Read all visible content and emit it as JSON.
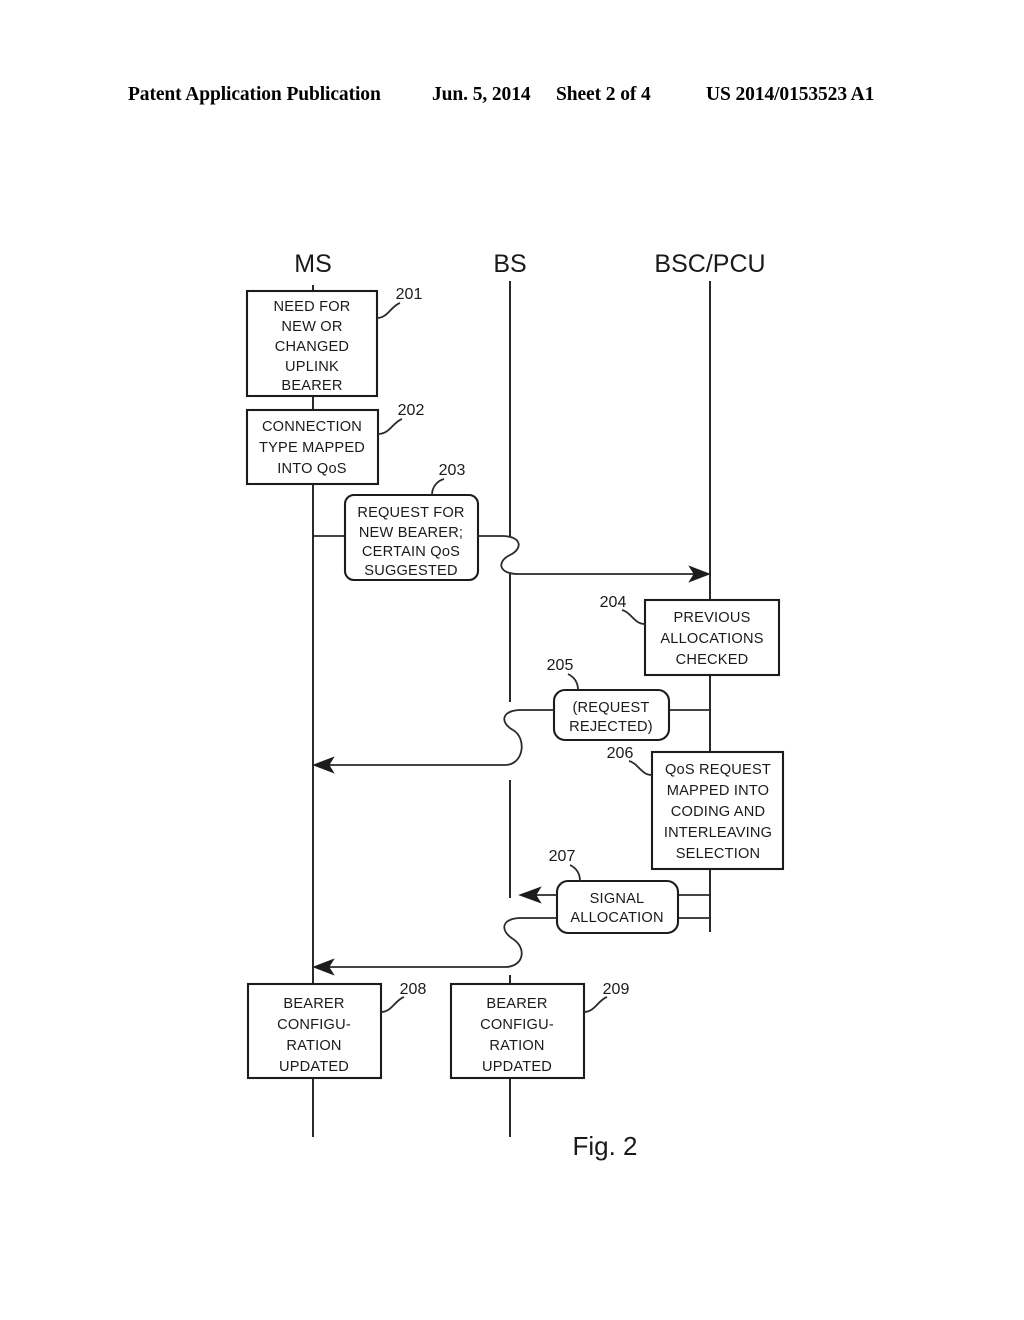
{
  "header": {
    "publication": "Patent Application Publication",
    "date": "Jun. 5, 2014",
    "sheet": "Sheet 2 of 4",
    "patent_number": "US 2014/0153523 A1"
  },
  "figure": {
    "caption": "Fig. 2",
    "lifelines": [
      {
        "id": "ms",
        "label": "MS"
      },
      {
        "id": "bs",
        "label": "BS"
      },
      {
        "id": "bscpcu",
        "label": "BSC/PCU"
      }
    ],
    "boxes": [
      {
        "ref": "201",
        "lines": [
          "NEED FOR",
          "NEW OR",
          "CHANGED",
          "UPLINK",
          "BEARER"
        ],
        "shape": "rect",
        "lane": "ms"
      },
      {
        "ref": "202",
        "lines": [
          "CONNECTION",
          "TYPE MAPPED",
          "INTO QoS"
        ],
        "shape": "rect",
        "lane": "ms"
      },
      {
        "ref": "203",
        "lines": [
          "REQUEST FOR",
          "NEW BEARER;",
          "CERTAIN QoS",
          "SUGGESTED"
        ],
        "shape": "rounded",
        "lane": "ms-bs"
      },
      {
        "ref": "204",
        "lines": [
          "PREVIOUS",
          "ALLOCATIONS",
          "CHECKED"
        ],
        "shape": "rect",
        "lane": "bscpcu"
      },
      {
        "ref": "205",
        "lines": [
          "(REQUEST",
          "REJECTED)"
        ],
        "shape": "rounded",
        "lane": "bs-bscpcu"
      },
      {
        "ref": "206",
        "lines": [
          "QoS REQUEST",
          "MAPPED INTO",
          "CODING AND",
          "INTERLEAVING",
          "SELECTION"
        ],
        "shape": "rect",
        "lane": "bscpcu"
      },
      {
        "ref": "207",
        "lines": [
          "SIGNAL",
          "ALLOCATION"
        ],
        "shape": "rounded",
        "lane": "bs-bscpcu"
      },
      {
        "ref": "208",
        "lines": [
          "BEARER",
          "CONFIGU-",
          "RATION",
          "UPDATED"
        ],
        "shape": "rect",
        "lane": "ms"
      },
      {
        "ref": "209",
        "lines": [
          "BEARER",
          "CONFIGU-",
          "RATION",
          "UPDATED"
        ],
        "shape": "rect",
        "lane": "bs"
      }
    ],
    "colors": {
      "ink": "#1c1c1c",
      "paper": "#ffffff"
    }
  }
}
